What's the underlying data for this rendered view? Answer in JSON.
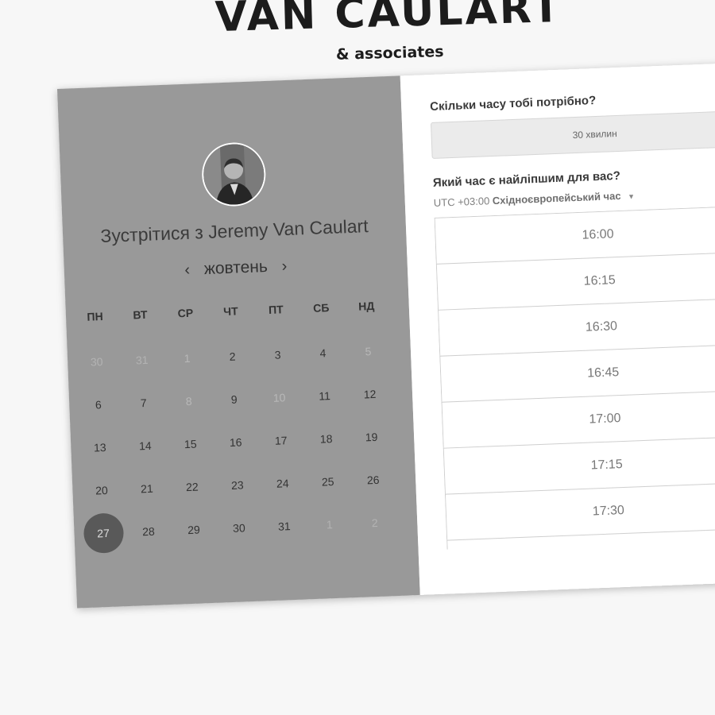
{
  "brand": {
    "name": "VAN CAULART",
    "sub": "& associates"
  },
  "scheduler": {
    "title_prefix": "Зустрітися з",
    "host_name": "Jeremy Van Caulart",
    "month": "жовтень",
    "prev": "‹",
    "next": "›",
    "weekdays": [
      "ПН",
      "ВТ",
      "СР",
      "ЧТ",
      "ПТ",
      "СБ",
      "НД"
    ],
    "days": [
      {
        "d": "30",
        "state": "muted"
      },
      {
        "d": "31",
        "state": "muted"
      },
      {
        "d": "1",
        "state": "disabled"
      },
      {
        "d": "2",
        "state": "normal"
      },
      {
        "d": "3",
        "state": "normal"
      },
      {
        "d": "4",
        "state": "normal"
      },
      {
        "d": "5",
        "state": "disabled"
      },
      {
        "d": "6",
        "state": "normal"
      },
      {
        "d": "7",
        "state": "normal"
      },
      {
        "d": "8",
        "state": "disabled"
      },
      {
        "d": "9",
        "state": "normal"
      },
      {
        "d": "10",
        "state": "disabled"
      },
      {
        "d": "11",
        "state": "normal"
      },
      {
        "d": "12",
        "state": "normal"
      },
      {
        "d": "13",
        "state": "normal"
      },
      {
        "d": "14",
        "state": "normal"
      },
      {
        "d": "15",
        "state": "normal"
      },
      {
        "d": "16",
        "state": "normal"
      },
      {
        "d": "17",
        "state": "normal"
      },
      {
        "d": "18",
        "state": "normal"
      },
      {
        "d": "19",
        "state": "normal"
      },
      {
        "d": "20",
        "state": "normal"
      },
      {
        "d": "21",
        "state": "normal"
      },
      {
        "d": "22",
        "state": "normal"
      },
      {
        "d": "23",
        "state": "normal"
      },
      {
        "d": "24",
        "state": "normal"
      },
      {
        "d": "25",
        "state": "normal"
      },
      {
        "d": "26",
        "state": "normal"
      },
      {
        "d": "27",
        "state": "selected"
      },
      {
        "d": "28",
        "state": "normal"
      },
      {
        "d": "29",
        "state": "normal"
      },
      {
        "d": "30",
        "state": "normal"
      },
      {
        "d": "31",
        "state": "normal"
      },
      {
        "d": "1",
        "state": "muted"
      },
      {
        "d": "2",
        "state": "muted"
      }
    ]
  },
  "booking": {
    "duration_question": "Скільки часу тобі потрібно?",
    "duration_value": "30 хвилин",
    "time_question": "Який час є найліпшим для вас?",
    "tz_offset": "UTC +03:00",
    "tz_name": "Східноєвропейський час",
    "slots": [
      "16:00",
      "16:15",
      "16:30",
      "16:45",
      "17:00",
      "17:15",
      "17:30",
      ""
    ]
  },
  "colors": {
    "left_panel": "#999999",
    "selected_day": "#595959"
  }
}
